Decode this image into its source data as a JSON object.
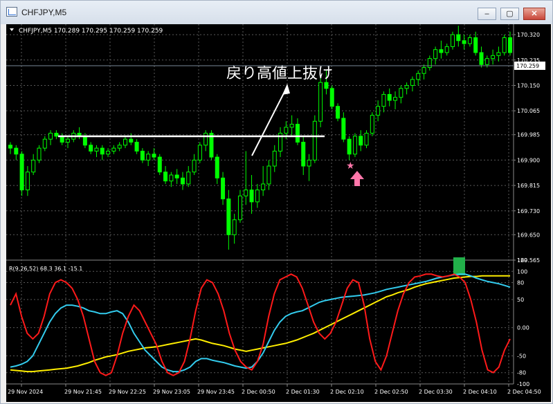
{
  "window": {
    "title": "CHFJPY,M5",
    "buttons": {
      "minimize": "–",
      "maximize": "▢",
      "close": "✕"
    }
  },
  "chart": {
    "symbol_info": "CHFJPY,M5  170.289 170.295 170.259 170.259",
    "annotation": "戻り高値上抜け",
    "current_price": "170.259",
    "price_axis": [
      "170.320",
      "170.235",
      "170.150",
      "170.065",
      "169.985",
      "169.900",
      "169.815",
      "169.730",
      "169.650",
      "169.565"
    ],
    "indicator_label": "R(9,26,52) 68.3 36.1 -15.1",
    "indicator_axis": [
      "120",
      "100",
      "80",
      "50",
      "0.00",
      "-50",
      "-80",
      "-100"
    ],
    "time_axis": [
      "29 Nov 2024",
      "29 Nov 21:45",
      "29 Nov 22:25",
      "29 Nov 23:05",
      "29 Nov 23:45",
      "2 Dec 00:50",
      "2 Dec 01:30",
      "2 Dec 02:10",
      "2 Dec 02:50",
      "2 Dec 03:30",
      "2 Dec 04:10",
      "2 Dec 04:50"
    ],
    "colors": {
      "candle": "#00ff00",
      "grid": "#5a5a5a",
      "axis_text": "#ffffff",
      "annotation": "#ffffff",
      "marker": "#ff77aa",
      "line_red": "#ff1a1a",
      "line_cyan": "#33ccee",
      "line_yellow": "#ffee00",
      "signal_box": "#22b04a"
    }
  },
  "chart_data": {
    "type": "candlestick",
    "ylim": [
      169.565,
      170.355
    ],
    "candles": [
      [
        169.95,
        169.96,
        169.92,
        169.94
      ],
      [
        169.94,
        169.95,
        169.9,
        169.92
      ],
      [
        169.92,
        169.93,
        169.78,
        169.8
      ],
      [
        169.8,
        169.88,
        169.78,
        169.86
      ],
      [
        169.86,
        169.92,
        169.85,
        169.9
      ],
      [
        169.9,
        169.95,
        169.89,
        169.94
      ],
      [
        169.94,
        169.98,
        169.93,
        169.97
      ],
      [
        169.97,
        170.0,
        169.95,
        169.99
      ],
      [
        169.99,
        170.0,
        169.97,
        169.98
      ],
      [
        169.98,
        169.99,
        169.95,
        169.96
      ],
      [
        169.96,
        169.98,
        169.94,
        169.97
      ],
      [
        169.97,
        170.0,
        169.96,
        169.99
      ],
      [
        169.99,
        170.01,
        169.97,
        169.98
      ],
      [
        169.98,
        169.99,
        169.94,
        169.95
      ],
      [
        169.95,
        169.96,
        169.92,
        169.93
      ],
      [
        169.93,
        169.95,
        169.91,
        169.94
      ],
      [
        169.94,
        169.95,
        169.9,
        169.92
      ],
      [
        169.92,
        169.94,
        169.91,
        169.93
      ],
      [
        169.93,
        169.95,
        169.92,
        169.94
      ],
      [
        169.94,
        169.96,
        169.93,
        169.95
      ],
      [
        169.95,
        169.98,
        169.94,
        169.97
      ],
      [
        169.97,
        169.99,
        169.95,
        169.96
      ],
      [
        169.96,
        169.97,
        169.92,
        169.93
      ],
      [
        169.93,
        169.94,
        169.89,
        169.9
      ],
      [
        169.9,
        169.93,
        169.88,
        169.92
      ],
      [
        169.92,
        169.94,
        169.9,
        169.91
      ],
      [
        169.91,
        169.92,
        169.85,
        169.86
      ],
      [
        169.86,
        169.88,
        169.82,
        169.83
      ],
      [
        169.83,
        169.86,
        169.81,
        169.85
      ],
      [
        169.85,
        169.87,
        169.82,
        169.84
      ],
      [
        169.84,
        169.86,
        169.8,
        169.82
      ],
      [
        169.82,
        169.88,
        169.81,
        169.86
      ],
      [
        169.86,
        169.92,
        169.85,
        169.9
      ],
      [
        169.9,
        169.96,
        169.89,
        169.95
      ],
      [
        169.95,
        170.0,
        169.93,
        169.99
      ],
      [
        169.99,
        170.0,
        169.9,
        169.91
      ],
      [
        169.91,
        169.92,
        169.82,
        169.84
      ],
      [
        169.84,
        169.86,
        169.75,
        169.77
      ],
      [
        169.77,
        169.8,
        169.6,
        169.65
      ],
      [
        169.65,
        169.72,
        169.62,
        169.7
      ],
      [
        169.7,
        169.8,
        169.69,
        169.78
      ],
      [
        169.78,
        169.93,
        169.75,
        169.8
      ],
      [
        169.8,
        169.85,
        169.72,
        169.76
      ],
      [
        169.76,
        169.82,
        169.74,
        169.8
      ],
      [
        169.8,
        169.88,
        169.78,
        169.82
      ],
      [
        169.82,
        169.9,
        169.8,
        169.88
      ],
      [
        169.88,
        169.95,
        169.86,
        169.93
      ],
      [
        169.93,
        170.01,
        169.91,
        169.99
      ],
      [
        169.99,
        170.03,
        169.97,
        170.01
      ],
      [
        170.01,
        170.05,
        169.98,
        170.02
      ],
      [
        170.02,
        170.04,
        169.95,
        169.96
      ],
      [
        169.96,
        169.98,
        169.85,
        169.88
      ],
      [
        169.88,
        169.92,
        169.83,
        169.9
      ],
      [
        169.9,
        170.05,
        169.89,
        170.03
      ],
      [
        170.03,
        170.18,
        170.01,
        170.16
      ],
      [
        170.16,
        170.2,
        170.12,
        170.14
      ],
      [
        170.14,
        170.15,
        170.07,
        170.08
      ],
      [
        170.08,
        170.09,
        170.03,
        170.04
      ],
      [
        170.04,
        170.06,
        169.96,
        169.97
      ],
      [
        169.97,
        169.98,
        169.9,
        169.92
      ],
      [
        169.92,
        169.99,
        169.91,
        169.98
      ],
      [
        169.98,
        170.0,
        169.93,
        169.95
      ],
      [
        169.95,
        170.0,
        169.94,
        169.99
      ],
      [
        169.99,
        170.06,
        169.98,
        170.05
      ],
      [
        170.05,
        170.1,
        170.03,
        170.08
      ],
      [
        170.08,
        170.13,
        170.06,
        170.12
      ],
      [
        170.12,
        170.14,
        170.08,
        170.1
      ],
      [
        170.1,
        170.13,
        170.07,
        170.11
      ],
      [
        170.11,
        170.15,
        170.09,
        170.14
      ],
      [
        170.14,
        170.16,
        170.12,
        170.15
      ],
      [
        170.15,
        170.18,
        170.13,
        170.17
      ],
      [
        170.17,
        170.2,
        170.15,
        170.19
      ],
      [
        170.19,
        170.22,
        170.17,
        170.21
      ],
      [
        170.21,
        170.25,
        170.2,
        170.24
      ],
      [
        170.24,
        170.28,
        170.22,
        170.27
      ],
      [
        170.27,
        170.3,
        170.24,
        170.26
      ],
      [
        170.26,
        170.29,
        170.25,
        170.28
      ],
      [
        170.28,
        170.33,
        170.27,
        170.32
      ],
      [
        170.32,
        170.35,
        170.28,
        170.3
      ],
      [
        170.3,
        170.32,
        170.27,
        170.29
      ],
      [
        170.29,
        170.32,
        170.28,
        170.31
      ],
      [
        170.31,
        170.33,
        170.25,
        170.26
      ],
      [
        170.26,
        170.28,
        170.21,
        170.22
      ],
      [
        170.22,
        170.25,
        170.21,
        170.24
      ],
      [
        170.24,
        170.27,
        170.22,
        170.25
      ],
      [
        170.25,
        170.28,
        170.23,
        170.26
      ],
      [
        170.26,
        170.32,
        170.25,
        170.31
      ],
      [
        170.31,
        170.33,
        170.25,
        170.26
      ]
    ],
    "indicator_ylim": [
      -100,
      120
    ],
    "red": [
      40,
      60,
      20,
      -10,
      -20,
      -10,
      20,
      60,
      80,
      85,
      80,
      70,
      50,
      20,
      -20,
      -60,
      -80,
      -85,
      -80,
      -50,
      -10,
      20,
      40,
      30,
      10,
      -10,
      -30,
      -60,
      -80,
      -85,
      -80,
      -60,
      -20,
      30,
      70,
      85,
      80,
      60,
      30,
      -10,
      -40,
      -60,
      -70,
      -75,
      -60,
      -30,
      20,
      60,
      85,
      90,
      95,
      90,
      70,
      40,
      10,
      -10,
      -20,
      -10,
      10,
      40,
      70,
      85,
      80,
      40,
      -20,
      -60,
      -75,
      -50,
      -10,
      30,
      60,
      80,
      90,
      92,
      95,
      95,
      92,
      90,
      92,
      95,
      90,
      80,
      50,
      10,
      -40,
      -75,
      -80,
      -70,
      -40,
      -20
    ],
    "cyan": [
      -70,
      -68,
      -65,
      -60,
      -50,
      -30,
      -10,
      10,
      25,
      35,
      40,
      40,
      38,
      35,
      30,
      28,
      25,
      25,
      28,
      30,
      25,
      10,
      -10,
      -25,
      -40,
      -50,
      -60,
      -70,
      -75,
      -78,
      -78,
      -75,
      -70,
      -60,
      -55,
      -55,
      -58,
      -60,
      -62,
      -65,
      -68,
      -70,
      -72,
      -70,
      -60,
      -45,
      -25,
      -5,
      10,
      20,
      25,
      28,
      30,
      35,
      40,
      45,
      48,
      50,
      52,
      54,
      55,
      56,
      57,
      58,
      60,
      62,
      65,
      68,
      70,
      72,
      74,
      76,
      78,
      80,
      82,
      85,
      88,
      90,
      92,
      94,
      95,
      95,
      92,
      88,
      85,
      82,
      80,
      78,
      75,
      72
    ],
    "yellow": [
      -75,
      -76,
      -77,
      -78,
      -78,
      -77,
      -76,
      -75,
      -74,
      -73,
      -72,
      -70,
      -68,
      -65,
      -62,
      -58,
      -55,
      -52,
      -50,
      -48,
      -45,
      -42,
      -40,
      -38,
      -36,
      -35,
      -34,
      -32,
      -30,
      -28,
      -26,
      -24,
      -22,
      -20,
      -22,
      -25,
      -28,
      -30,
      -32,
      -35,
      -38,
      -40,
      -42,
      -40,
      -38,
      -36,
      -34,
      -32,
      -30,
      -28,
      -25,
      -22,
      -18,
      -14,
      -10,
      -5,
      0,
      5,
      10,
      15,
      20,
      25,
      30,
      35,
      40,
      45,
      50,
      55,
      58,
      62,
      65,
      68,
      72,
      75,
      78,
      80,
      82,
      84,
      86,
      88,
      89,
      90,
      91,
      91,
      92,
      92,
      92,
      92,
      92,
      92
    ]
  }
}
